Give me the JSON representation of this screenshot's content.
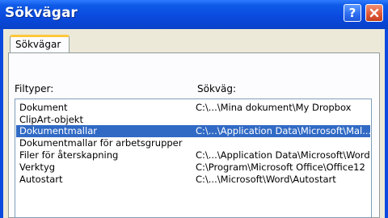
{
  "window": {
    "title": "Sökvägar",
    "help_label": "?"
  },
  "tabs": [
    {
      "label": "Sökvägar",
      "selected": true
    }
  ],
  "labels": {
    "filetypes": "Filtyper:",
    "path": "Sökväg:"
  },
  "rows": [
    {
      "type": "Dokument",
      "path": "C:\\...\\Mina dokument\\My Dropbox",
      "selected": false
    },
    {
      "type": "ClipArt-objekt",
      "path": "",
      "selected": false
    },
    {
      "type": "Dokumentmallar",
      "path": "C:\\...\\Application Data\\Microsoft\\Mal...",
      "selected": true
    },
    {
      "type": "Dokumentmallar för arbetsgrupper",
      "path": "",
      "selected": false
    },
    {
      "type": "Filer för återskapning",
      "path": "C:\\...\\Application Data\\Microsoft\\Word",
      "selected": false
    },
    {
      "type": "Verktyg",
      "path": "C:\\Program\\Microsoft Office\\Office12",
      "selected": false
    },
    {
      "type": "Autostart",
      "path": "C:\\...\\Microsoft\\Word\\Autostart",
      "selected": false
    }
  ],
  "colors": {
    "titlebar": "#0A4ADF",
    "selection": "#316AC5",
    "dialog_face": "#ECE9D8",
    "tab_highlight": "#FFC83C"
  },
  "icons": {
    "help": "question-mark",
    "close": "x-mark"
  }
}
